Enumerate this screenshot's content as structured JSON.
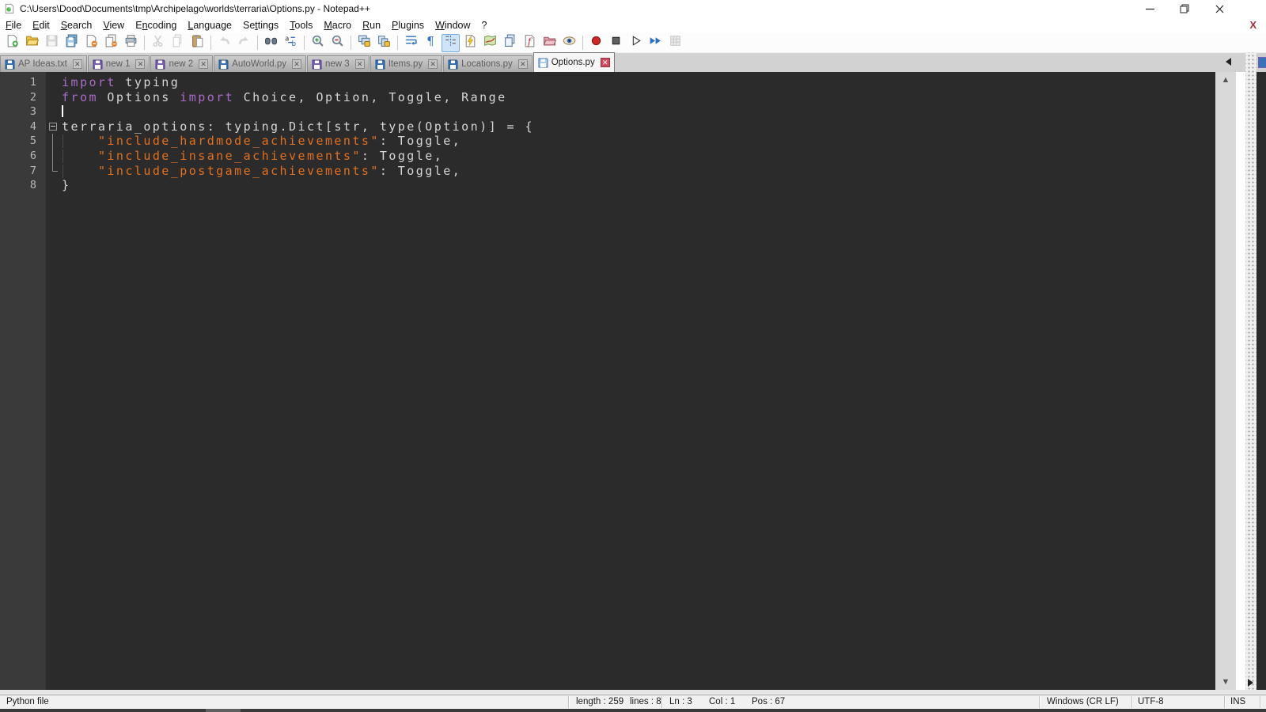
{
  "window": {
    "title": "C:\\Users\\Dood\\Documents\\tmp\\Archipelago\\worlds\\terraria\\Options.py - Notepad++"
  },
  "menu": {
    "items": [
      {
        "label": "File",
        "u": 0
      },
      {
        "label": "Edit",
        "u": 0
      },
      {
        "label": "Search",
        "u": 0
      },
      {
        "label": "View",
        "u": 0
      },
      {
        "label": "Encoding",
        "u": 1
      },
      {
        "label": "Language",
        "u": 0
      },
      {
        "label": "Settings",
        "u": 2
      },
      {
        "label": "Tools",
        "u": 0
      },
      {
        "label": "Macro",
        "u": 0
      },
      {
        "label": "Run",
        "u": 0
      },
      {
        "label": "Plugins",
        "u": 0
      },
      {
        "label": "Window",
        "u": 0
      },
      {
        "label": "?",
        "u": -1
      }
    ],
    "close_label": "X"
  },
  "toolbar": {
    "groups": [
      [
        {
          "icon": "new-file"
        },
        {
          "icon": "open-file"
        },
        {
          "icon": "save",
          "disabled": true
        },
        {
          "icon": "save-all"
        },
        {
          "icon": "close-doc"
        },
        {
          "icon": "close-all"
        },
        {
          "icon": "print"
        }
      ],
      [
        {
          "icon": "cut",
          "disabled": true
        },
        {
          "icon": "copy",
          "disabled": true
        },
        {
          "icon": "paste"
        }
      ],
      [
        {
          "icon": "undo",
          "disabled": true
        },
        {
          "icon": "redo",
          "disabled": true
        }
      ],
      [
        {
          "icon": "find"
        },
        {
          "icon": "replace"
        }
      ],
      [
        {
          "icon": "zoom-in"
        },
        {
          "icon": "zoom-out"
        }
      ],
      [
        {
          "icon": "sync-scroll-vertical"
        },
        {
          "icon": "sync-scroll-horizontal"
        }
      ],
      [
        {
          "icon": "word-wrap"
        },
        {
          "icon": "show-all-chars"
        },
        {
          "icon": "indent-guide",
          "pressed": true
        },
        {
          "icon": "lightning-doc"
        },
        {
          "icon": "map"
        },
        {
          "icon": "documents"
        },
        {
          "icon": "function-list"
        },
        {
          "icon": "folder"
        },
        {
          "icon": "eye"
        }
      ],
      [
        {
          "icon": "record-macro"
        },
        {
          "icon": "stop-macro"
        },
        {
          "icon": "play-macro"
        },
        {
          "icon": "fast-forward"
        },
        {
          "icon": "macro-save",
          "disabled": true
        }
      ]
    ]
  },
  "tabs": [
    {
      "label": "AP Ideas.txt",
      "floppy": "blue",
      "active": false
    },
    {
      "label": "new 1",
      "floppy": "purple",
      "active": false
    },
    {
      "label": "new 2",
      "floppy": "purple",
      "active": false
    },
    {
      "label": "AutoWorld.py",
      "floppy": "blue",
      "active": false
    },
    {
      "label": "new 3",
      "floppy": "purple",
      "active": false
    },
    {
      "label": "Items.py",
      "floppy": "blue",
      "active": false
    },
    {
      "label": "Locations.py",
      "floppy": "blue",
      "active": false
    },
    {
      "label": "Options.py",
      "floppy": "light",
      "active": true
    }
  ],
  "editor": {
    "lines": [
      {
        "n": "1",
        "fold": "",
        "tokens": [
          [
            "import",
            "kw"
          ],
          [
            " typing",
            "def"
          ]
        ]
      },
      {
        "n": "2",
        "fold": "",
        "tokens": [
          [
            "from",
            "kw"
          ],
          [
            " Options ",
            "def"
          ],
          [
            "import",
            "kw"
          ],
          [
            " Choice, Option, Toggle, Range",
            "def"
          ]
        ]
      },
      {
        "n": "3",
        "fold": "",
        "caret": true,
        "tokens": []
      },
      {
        "n": "4",
        "fold": "minus",
        "tokens": [
          [
            "terraria_options: typing.Dict[str, type(Option)] = {",
            "def"
          ]
        ]
      },
      {
        "n": "5",
        "fold": "line",
        "guide": true,
        "tokens": [
          [
            "    ",
            "def"
          ],
          [
            "\"include_hardmode_achievements\"",
            "str"
          ],
          [
            ": Toggle,",
            "def"
          ]
        ]
      },
      {
        "n": "6",
        "fold": "line",
        "guide": true,
        "tokens": [
          [
            "    ",
            "def"
          ],
          [
            "\"include_insane_achievements\"",
            "str"
          ],
          [
            ": Toggle,",
            "def"
          ]
        ]
      },
      {
        "n": "7",
        "fold": "corner",
        "guide": true,
        "tokens": [
          [
            "    ",
            "def"
          ],
          [
            "\"include_postgame_achievements\"",
            "str"
          ],
          [
            ": Toggle,",
            "def"
          ]
        ]
      },
      {
        "n": "8",
        "fold": "",
        "tokens": [
          [
            "}",
            "def"
          ]
        ]
      }
    ],
    "caret_position": {
      "line": 3,
      "col": 1
    }
  },
  "statusbar": {
    "doc_type": "Python file",
    "length": "length : 259",
    "lines": "lines : 8",
    "ln": "Ln : 3",
    "col": "Col : 1",
    "pos": "Pos : 67",
    "eol": "Windows (CR LF)",
    "encoding": "UTF-8",
    "typing_mode": "INS"
  },
  "colors": {
    "keyword": "#a86bc8",
    "string": "#e2701e",
    "default_text": "#d6d6d6",
    "editor_bg": "#2b2b2b",
    "margin_bg": "#3a3a3a",
    "active_tab_close": "#cf4a5e"
  }
}
